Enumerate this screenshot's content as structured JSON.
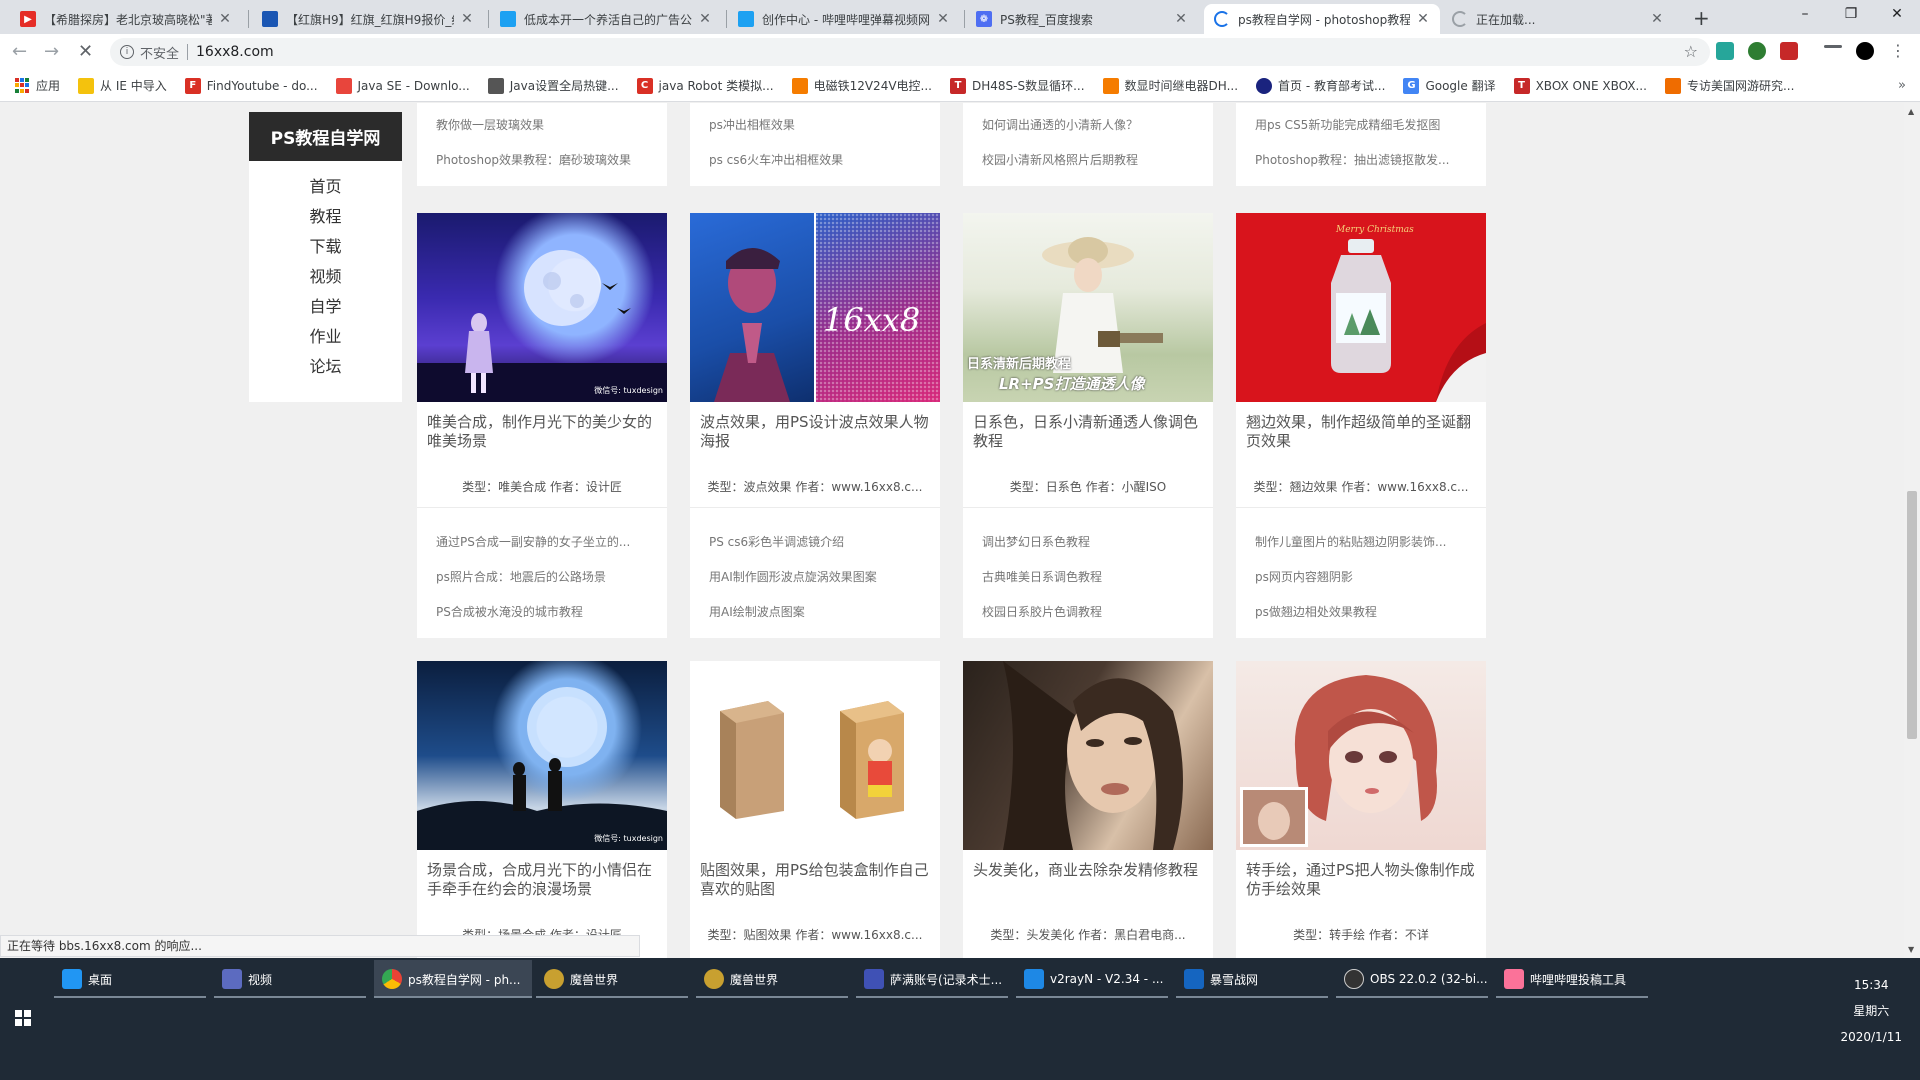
{
  "browser": {
    "tabs": [
      {
        "title": "【希腊探房】老北京玻高晓松\"著",
        "color": "#e52d27",
        "active": false
      },
      {
        "title": "【红旗H9】红旗_红旗H9报价_红",
        "color": "#1a56b3",
        "active": false
      },
      {
        "title": "低成本开一个养活自己的广告公",
        "color": "#1da1f2",
        "active": false
      },
      {
        "title": "创作中心 - 哔哩哔哩弹幕视频网",
        "color": "#1da1f2",
        "active": false
      },
      {
        "title": "PS教程_百度搜索",
        "color": "#4e6ef2",
        "active": false
      },
      {
        "title": "ps教程自学网 - photoshop教程",
        "color": "#1a73e8",
        "active": true
      },
      {
        "title": "正在加载...",
        "color": "#9aa0a6",
        "active": false
      }
    ],
    "new_tab": "+",
    "window_controls": {
      "minimize": "–",
      "maximize": "❐",
      "close": "✕"
    },
    "toolbar": {
      "back": "←",
      "forward": "→",
      "reload": "✕",
      "security_label": "不安全",
      "url": "16xx8.com",
      "star": "☆"
    },
    "bookmarks": [
      {
        "label": "应用",
        "color": "#d93025"
      },
      {
        "label": "从 IE 中导入",
        "color": "#f4c20d"
      },
      {
        "label": "FindYoutube - do...",
        "color": "#d93025"
      },
      {
        "label": "Java SE - Downlo...",
        "color": "#e8453c"
      },
      {
        "label": "Java设置全局热键...",
        "color": "#555555"
      },
      {
        "label": "java Robot 类模拟...",
        "color": "#d93025"
      },
      {
        "label": "电磁铁12V24V电控...",
        "color": "#f57c00"
      },
      {
        "label": "DH48S-S数显循环...",
        "color": "#c62828"
      },
      {
        "label": "数显时间继电器DH...",
        "color": "#f57c00"
      },
      {
        "label": "首页 - 教育部考试...",
        "color": "#1a237e"
      },
      {
        "label": "Google 翻译",
        "color": "#4285f4"
      },
      {
        "label": "XBOX ONE XBOX...",
        "color": "#c62828"
      },
      {
        "label": "专访美国网游研究...",
        "color": "#ef6c00"
      }
    ],
    "bookmarks_more": "»",
    "status": "正在等待 bbs.16xx8.com 的响应..."
  },
  "site": {
    "logo": "PS教程自学网",
    "nav": [
      "首页",
      "教程",
      "下载",
      "视频",
      "自学",
      "作业",
      "论坛"
    ]
  },
  "top_partial_cards": [
    {
      "links": [
        "教你做一层玻璃效果",
        "Photoshop效果教程：磨砂玻璃效果"
      ]
    },
    {
      "links": [
        "ps冲出相框效果",
        "ps cs6火车冲出相框效果"
      ]
    },
    {
      "links": [
        "如何调出通透的小清新人像？",
        "校园小清新风格照片后期教程"
      ]
    },
    {
      "links": [
        "用ps CS5新功能完成精细毛发抠图",
        "Photoshop教程：抽出滤镜抠散发..."
      ]
    }
  ],
  "cards_row1": [
    {
      "title": "唯美合成，制作月光下的美少女的唯美场景",
      "meta": "类型：唯美合成  作者：设计匠",
      "watermark": "微信号: tuxdesign",
      "links": [
        "通过PS合成一副安静的女子坐立的...",
        "ps照片合成：地震后的公路场景",
        "PS合成被水淹没的城市教程"
      ]
    },
    {
      "title": "波点效果，用PS设计波点效果人物海报",
      "meta": "类型：波点效果  作者：www.16xx8.c...",
      "overlay": "16xx8",
      "links": [
        "PS cs6彩色半调滤镜介绍",
        "用AI制作圆形波点旋涡效果图案",
        "用AI绘制波点图案"
      ]
    },
    {
      "title": "日系色，日系小清新通透人像调色教程",
      "meta": "类型：日系色  作者：小醒ISO",
      "overlay": "日系清新后期教程",
      "overlay2": "LR+PS打造通透人像",
      "links": [
        "调出梦幻日系色教程",
        "古典唯美日系调色教程",
        "校园日系胶片色调教程"
      ]
    },
    {
      "title": "翘边效果，制作超级简单的圣诞翻页效果",
      "meta": "类型：翘边效果  作者：www.16xx8.c...",
      "overlay": "Merry Christmas",
      "links": [
        "制作儿童图片的粘贴翘边阴影装饰...",
        "ps网页内容翘阴影",
        "ps做翘边相处效果教程"
      ]
    }
  ],
  "cards_row2": [
    {
      "title": "场景合成，合成月光下的小情侣在手牵手在约会的浪漫场景",
      "meta": "类型：场景合成  作者：设计匠",
      "watermark": "微信号: tuxdesign"
    },
    {
      "title": "贴图效果，用PS给包装盒制作自己喜欢的贴图",
      "meta": "类型：贴图效果  作者：www.16xx8.c..."
    },
    {
      "title": "头发美化，商业去除杂发精修教程",
      "meta": "类型：头发美化  作者：黑白君电商..."
    },
    {
      "title": "转手绘，通过PS把人物头像制作成仿手绘效果",
      "meta": "类型：转手绘  作者：不详"
    }
  ],
  "taskbar": {
    "items": [
      {
        "label": "桌面",
        "color": "#2196f3",
        "active": false
      },
      {
        "label": "视频",
        "color": "#5c6bc0",
        "active": false
      },
      {
        "label": "ps教程自学网 - ph...",
        "color": "#4caf50",
        "active": true
      },
      {
        "label": "魔兽世界",
        "color": "#c8a030",
        "active": false
      },
      {
        "label": "魔兽世界",
        "color": "#c8a030",
        "active": false
      },
      {
        "label": "萨满账号(记录术士...",
        "color": "#3f51b5",
        "active": false
      },
      {
        "label": "v2rayN - V2.34 - ...",
        "color": "#1e88e5",
        "active": false
      },
      {
        "label": "暴雪战网",
        "color": "#1565c0",
        "active": false
      },
      {
        "label": "OBS 22.0.2 (32-bi...",
        "color": "#333333",
        "active": false
      },
      {
        "label": "哔哩哔哩投稿工具",
        "color": "#fb7299",
        "active": false
      }
    ],
    "time": "15:34",
    "weekday": "星期六",
    "date": "2020/1/11"
  }
}
